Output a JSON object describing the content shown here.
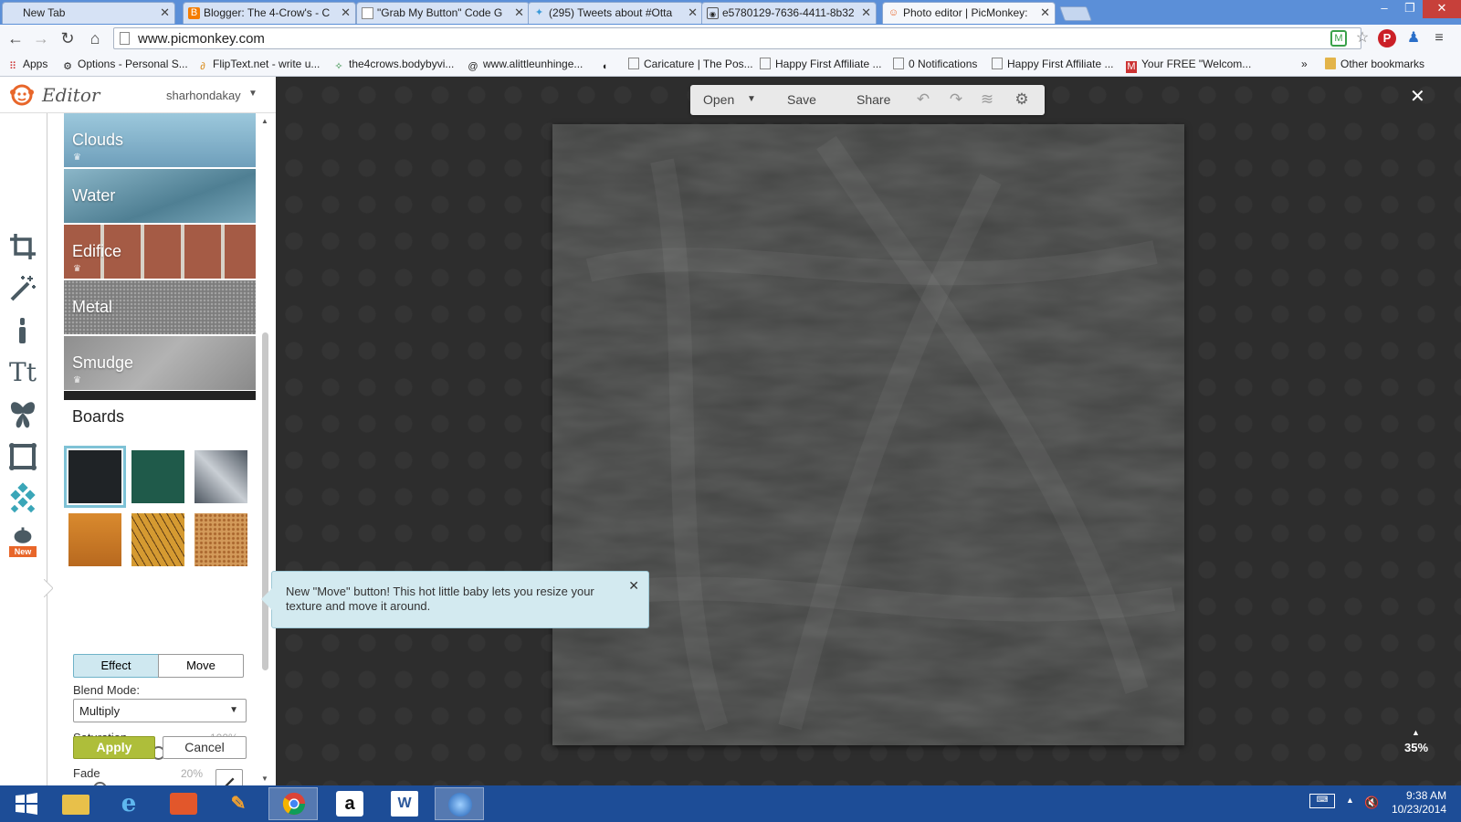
{
  "browser": {
    "tabs": [
      {
        "title": "New Tab",
        "favicon": "blank-icon"
      },
      {
        "title": "Blogger: The 4-Crow's - C",
        "favicon": "blogger-icon"
      },
      {
        "title": "\"Grab My Button\" Code G",
        "favicon": "page-icon"
      },
      {
        "title": "(295) Tweets about #Otta",
        "favicon": "twitter-icon"
      },
      {
        "title": "e5780129-7636-4411-8b32",
        "favicon": "camera-icon"
      },
      {
        "title": "Photo editor | PicMonkey:",
        "favicon": "picmonkey-icon"
      }
    ],
    "url": "www.picmonkey.com",
    "bookmarks": [
      {
        "label": "Apps",
        "icon": "apps-grid-icon"
      },
      {
        "label": "Options - Personal S...",
        "icon": "gear-icon"
      },
      {
        "label": "FlipText.net - write u...",
        "icon": "fliptext-icon"
      },
      {
        "label": "the4crows.bodybyvi...",
        "icon": "runner-icon"
      },
      {
        "label": "www.alittleunhinge...",
        "icon": "spiral-icon"
      },
      {
        "label": "",
        "icon": "egg-icon"
      },
      {
        "label": "Caricature | The Pos...",
        "icon": "page-icon"
      },
      {
        "label": "Happy First Affiliate ...",
        "icon": "page-icon"
      },
      {
        "label": "0 Notifications",
        "icon": "page-icon"
      },
      {
        "label": "Happy First Affiliate ...",
        "icon": "page-icon"
      },
      {
        "label": "Your FREE \"Welcom...",
        "icon": "mail-icon"
      }
    ],
    "bookmarks_overflow": "»",
    "other_bookmarks": "Other bookmarks"
  },
  "editor": {
    "logo_text": "Editor",
    "username": "sharhondakay",
    "textures": [
      {
        "label": "Clouds",
        "premium": true,
        "color": "#7fb4cd"
      },
      {
        "label": "Water",
        "premium": false,
        "color": "#6d9db3"
      },
      {
        "label": "Edifice",
        "premium": true,
        "color": "#a06a55"
      },
      {
        "label": "Metal",
        "premium": false,
        "color": "#8d8d8d"
      },
      {
        "label": "Smudge",
        "premium": true,
        "color": "#9e9e9e"
      }
    ],
    "section_title": "Boards",
    "boards": [
      {
        "name": "chalkboard-black",
        "color": "#1f2326"
      },
      {
        "name": "chalkboard-green",
        "color": "#1f5a4a"
      },
      {
        "name": "chalk-scribble",
        "color": "#606972"
      },
      {
        "name": "orange-rust",
        "color": "#c8792e"
      },
      {
        "name": "twig-orange",
        "color": "#c7852a"
      },
      {
        "name": "cork",
        "color": "#c98f4c"
      }
    ],
    "mode_tabs": {
      "effect": "Effect",
      "move": "Move"
    },
    "blend_mode_label": "Blend Mode:",
    "blend_mode_value": "Multiply",
    "saturation_label": "Saturation",
    "saturation_value": "100%",
    "saturation_level": 0.5,
    "fade_label": "Fade",
    "fade_value": "20%",
    "fade_level": 0.2,
    "apply_label": "Apply",
    "cancel_label": "Cancel",
    "tooltip_text": "New \"Move\" button! This hot little baby lets you resize your texture and move it around.",
    "new_badge": "New"
  },
  "workspace": {
    "actions": {
      "open": "Open",
      "save": "Save",
      "share": "Share"
    },
    "zoom": "35%"
  },
  "taskbar": {
    "time": "9:38 AM",
    "date": "10/23/2014",
    "apps": [
      "windows-start-icon",
      "file-explorer-icon",
      "internet-explorer-icon",
      "office-icon",
      "sketch-app-icon",
      "chrome-icon",
      "amazon-icon",
      "word-icon",
      "media-icon"
    ]
  },
  "colors": {
    "accent_apply": "#aebe3a",
    "tooltip_bg": "#d3eaf0",
    "effect_tab": "#cfe8f0",
    "canvas": "#424342",
    "brand_orange": "#e8662a"
  }
}
